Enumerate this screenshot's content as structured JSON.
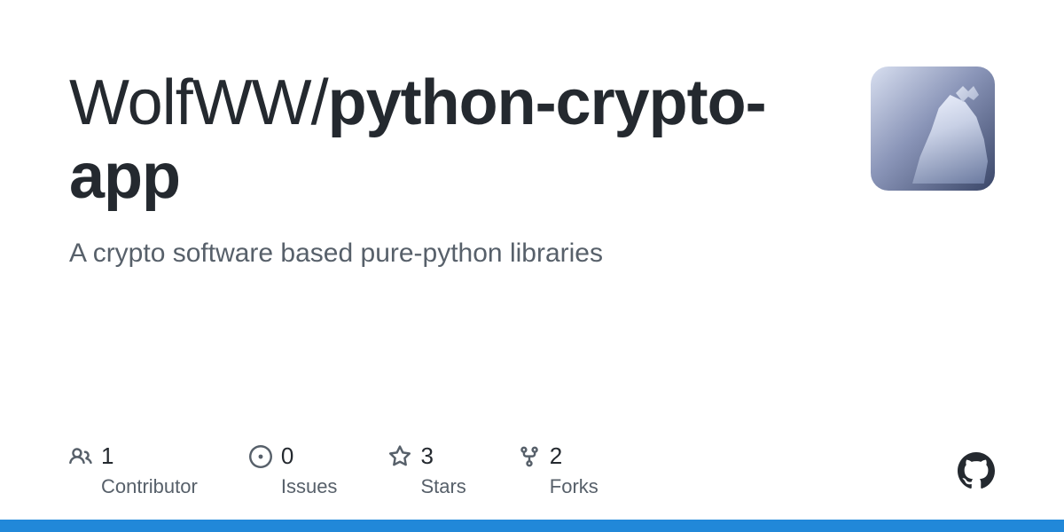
{
  "repo": {
    "owner": "WolfWW",
    "name": "python-crypto-app",
    "description": "A crypto software based pure-python libraries"
  },
  "stats": {
    "contributors": {
      "count": "1",
      "label": "Contributor"
    },
    "issues": {
      "count": "0",
      "label": "Issues"
    },
    "stars": {
      "count": "3",
      "label": "Stars"
    },
    "forks": {
      "count": "2",
      "label": "Forks"
    }
  }
}
